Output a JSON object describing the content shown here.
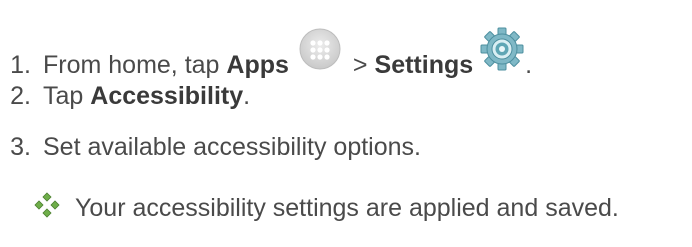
{
  "steps": [
    {
      "num": "1.",
      "prefix": "From home, tap ",
      "bold1": "Apps",
      "sep": ">",
      "bold2": "Settings",
      "suffix": ".",
      "apps_icon": "apps-grid-icon",
      "settings_icon": "gear-icon"
    },
    {
      "num": "2.",
      "prefix": "Tap ",
      "bold": "Accessibility",
      "suffix": "."
    },
    {
      "num": "3.",
      "text": "Set available accessibility options."
    }
  ],
  "result": {
    "icon": "result-diamond-bullet-icon",
    "text": "Your accessibility settings are applied and saved."
  },
  "colors": {
    "text": "#4a4a4a",
    "apps_icon": "#d6d6d6",
    "gear": "#5fa6b5",
    "bullet": "#6fae4a"
  }
}
